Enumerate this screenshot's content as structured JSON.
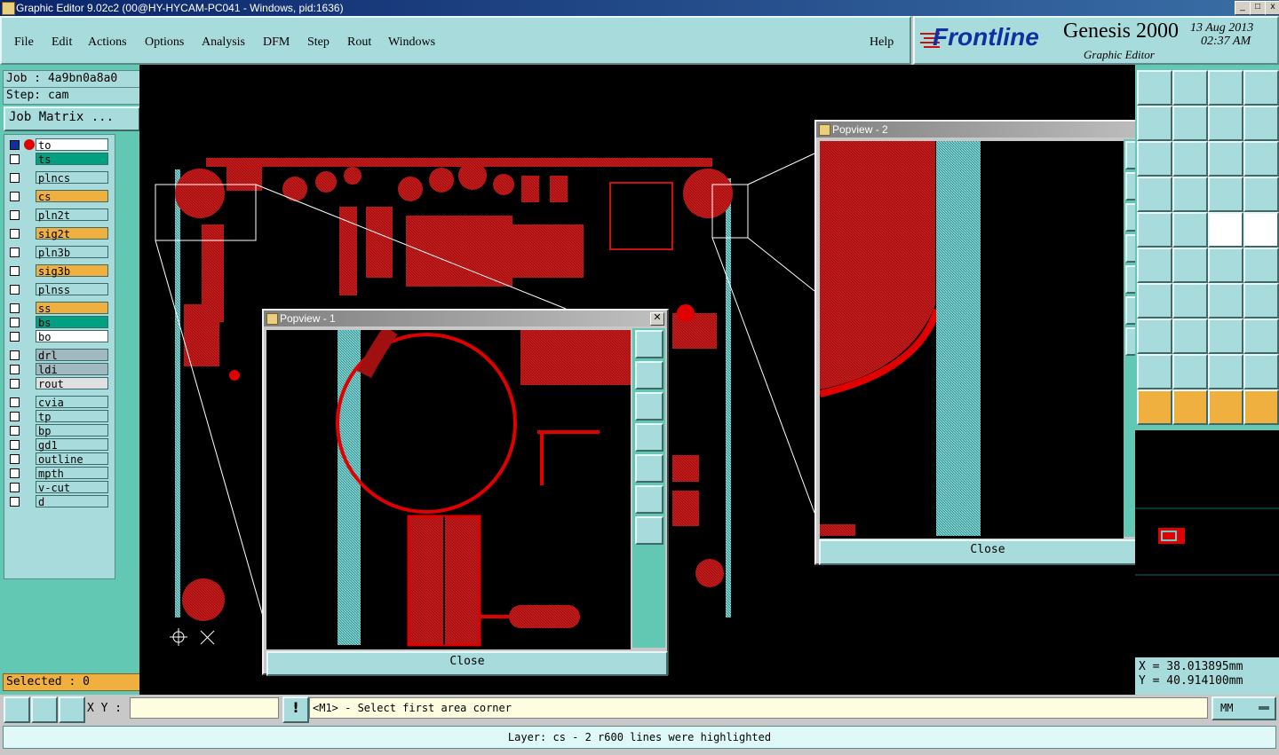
{
  "window": {
    "title": "Graphic Editor 9.02c2 (00@HY-HYCAM-PC041 - Windows, pid:1636)"
  },
  "menu": {
    "file": "File",
    "edit": "Edit",
    "actions": "Actions",
    "options": "Options",
    "analysis": "Analysis",
    "dfm": "DFM",
    "step": "Step",
    "rout": "Rout",
    "windows": "Windows",
    "help": "Help"
  },
  "brand": {
    "logo": "Frontline",
    "product": "Genesis 2000",
    "module": "Graphic Editor",
    "date": "13 Aug 2013",
    "time": "02:37 AM"
  },
  "job": {
    "job": "Job : 4a9bn0a8a0",
    "step": "Step: cam",
    "matrix_button": "Job Matrix ...",
    "selected": "Selected : 0"
  },
  "layers": [
    {
      "name": "to",
      "color": "#ffffff"
    },
    {
      "name": "ts",
      "color": "#00a080"
    },
    {
      "name": "plncs",
      "color": "#a8dcdc"
    },
    {
      "name": "cs",
      "color": "#f0b040"
    },
    {
      "name": "pln2t",
      "color": "#a8dcdc"
    },
    {
      "name": "sig2t",
      "color": "#f0b040"
    },
    {
      "name": "pln3b",
      "color": "#a8dcdc"
    },
    {
      "name": "sig3b",
      "color": "#f0b040"
    },
    {
      "name": "plnss",
      "color": "#a8dcdc"
    },
    {
      "name": "ss",
      "color": "#f0b040"
    },
    {
      "name": "bs",
      "color": "#00a080"
    },
    {
      "name": "bo",
      "color": "#ffffff"
    },
    {
      "name": "drl",
      "color": "#a0b8c0"
    },
    {
      "name": "ldi",
      "color": "#a0b8c0"
    },
    {
      "name": "rout",
      "color": "#e0e0e0"
    },
    {
      "name": "cvia",
      "color": "#a8dcdc"
    },
    {
      "name": "tp",
      "color": "#a8dcdc"
    },
    {
      "name": "bp",
      "color": "#a8dcdc"
    },
    {
      "name": "gd1",
      "color": "#a8dcdc"
    },
    {
      "name": "outline",
      "color": "#a8dcdc"
    },
    {
      "name": "mpth",
      "color": "#a8dcdc"
    },
    {
      "name": "v-cut",
      "color": "#a8dcdc"
    },
    {
      "name": "d",
      "color": "#a8dcdc"
    }
  ],
  "popview1": {
    "title": "Popview - 1",
    "close_label": "Close"
  },
  "popview2": {
    "title": "Popview - 2",
    "close_label": "Close"
  },
  "coords": {
    "x": "X = 38.013895mm",
    "y": "Y = 40.914100mm"
  },
  "bottom": {
    "xy_label": "X Y :",
    "xy_value": "",
    "prompt": "<M1> - Select first area corner",
    "units": "MM"
  },
  "status": {
    "message": "Layer: cs - 2 r600 lines were highlighted"
  },
  "colors": {
    "accent": "#a8dcdc",
    "panel": "#62c8b4",
    "pcb_red": "#cc1010",
    "pad_cyan": "#6ec8c8"
  }
}
